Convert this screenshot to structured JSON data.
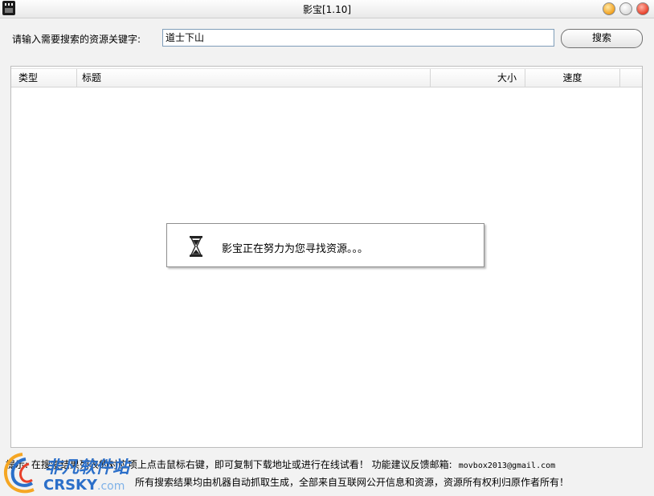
{
  "window": {
    "title": "影宝[1.10]"
  },
  "search": {
    "label": "请输入需要搜索的资源关键字:",
    "value": "道士下山",
    "button_label": "搜索"
  },
  "table": {
    "columns": [
      "类型",
      "标题",
      "大小",
      "速度"
    ],
    "rows": []
  },
  "loading": {
    "message": "影宝正在努力为您寻找资源。。。"
  },
  "footer": {
    "line1": "提示: 在搜索结果列表的对应项上点击鼠标右键，即可复制下载地址或进行在线试看！ 功能建议反馈邮箱:",
    "email": "movbox2013@gmail.com",
    "line2": "所有搜索结果均由机器自动抓取生成，全部来自互联网公开信息和资源，资源所有权利归原作者所有！"
  },
  "watermark": {
    "text_top": "非凡软件站",
    "text_bottom": "CRSKY",
    "text_suffix": ".com"
  },
  "icons": {
    "app": "film-clapper-icon",
    "loading": "hourglass-icon",
    "minimize": "minimize-icon",
    "maximize": "maximize-icon",
    "close": "close-icon"
  },
  "colors": {
    "minimize": "#f2a11f",
    "maximize": "#dcdcdc",
    "close": "#e8402a",
    "watermark": "#2b6fc9"
  }
}
